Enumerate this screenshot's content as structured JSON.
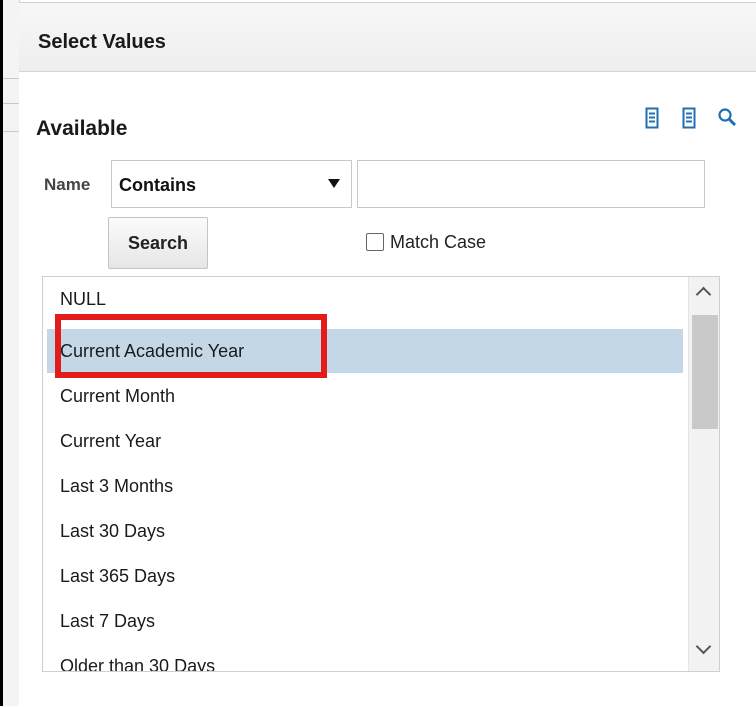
{
  "dialog": {
    "title": "Select Values"
  },
  "available": {
    "heading": "Available",
    "toolbar": [
      {
        "icon": "move-selected-icon",
        "color": "#1f6fb5"
      },
      {
        "icon": "move-all-icon",
        "color": "#1f6fb5"
      },
      {
        "icon": "search-icon",
        "color": "#1f6fb5"
      }
    ]
  },
  "filter": {
    "name_label": "Name",
    "operator": "Contains",
    "value": "",
    "search_label": "Search",
    "match_case_label": "Match Case",
    "match_case_checked": false
  },
  "list": {
    "items": [
      "NULL",
      "Current Academic Year",
      "Current Month",
      "Current Year",
      "Last 3 Months",
      "Last 30 Days",
      "Last 365 Days",
      "Last 7 Days",
      "Older than 30 Days"
    ],
    "selected_index": 1,
    "highlight_color": "#e21b1b",
    "selection_color": "#c4d7e7"
  }
}
